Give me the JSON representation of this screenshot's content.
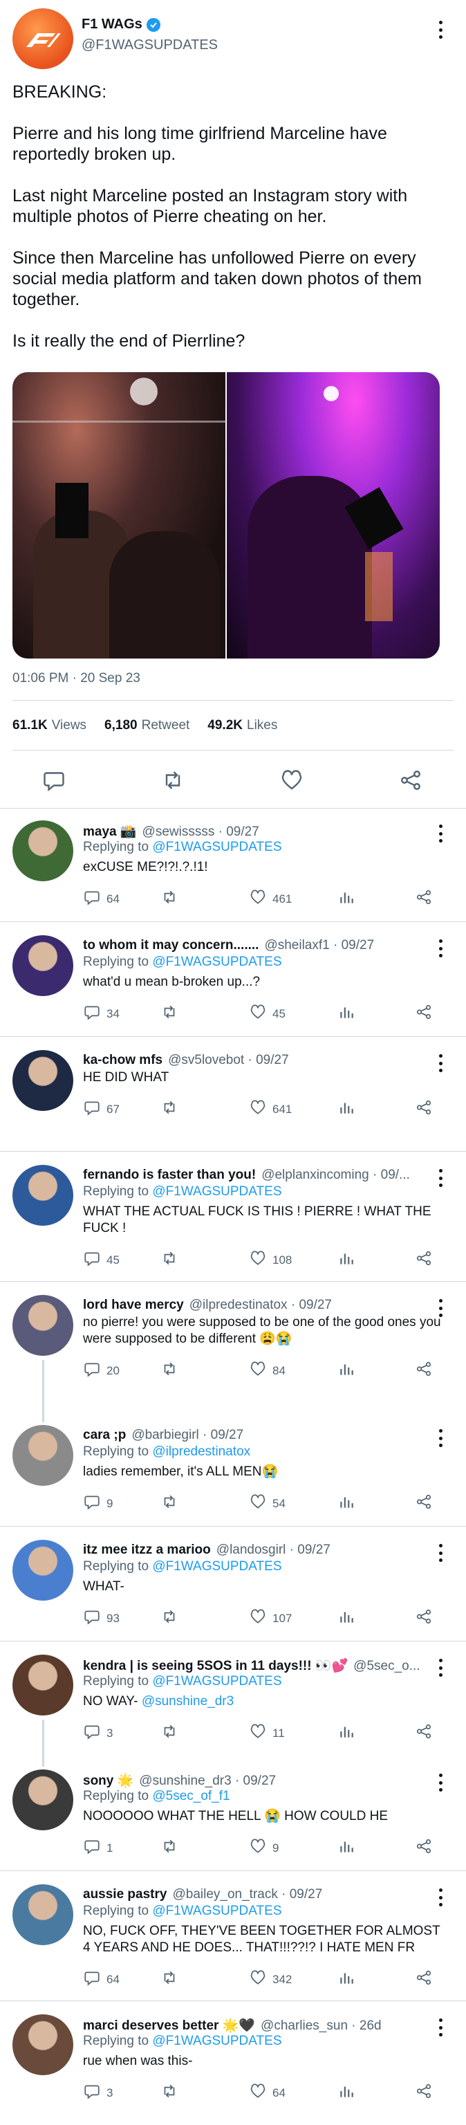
{
  "main_tweet": {
    "name": "F1 WAGs",
    "handle": "@F1WAGSUPDATES",
    "body": "BREAKING:\n\nPierre and his long time girlfriend Marceline have reportedly broken up.\n\nLast night Marceline posted an Instagram story with multiple photos of Pierre cheating on her.\n\nSince then Marceline has unfollowed Pierre on every social media platform and taken down photos of them together.\n\nIs it really the end of Pierrline?",
    "timestamp": "01:06 PM · 20 Sep 23",
    "views_count": "61.1K",
    "views_label": "Views",
    "retweets_count": "6,180",
    "retweets_label": "Retweet",
    "likes_count": "49.2K",
    "likes_label": "Likes"
  },
  "replies": [
    {
      "name": "maya 📸",
      "handle": "@sewisssss · 09/27",
      "replying_label": "Replying to",
      "replying_to": "@F1WAGSUPDATES",
      "text": "exCUSE ME?!?!.?.!1!",
      "mention": "",
      "comments": "64",
      "retweets": "",
      "likes": "461",
      "avatar": "#3f6a35"
    },
    {
      "name": "to whom it may concern.......",
      "handle": "@sheilaxf1 · 09/27",
      "replying_label": "Replying to",
      "replying_to": "@F1WAGSUPDATES",
      "text": "what'd u mean b-broken up...?",
      "mention": "",
      "comments": "34",
      "retweets": "",
      "likes": "45",
      "avatar": "#3b2a6e"
    },
    {
      "name": "ka-chow mfs",
      "handle": "@sv5lovebot · 09/27",
      "replying_label": "",
      "replying_to": "",
      "text": "HE DID WHAT",
      "mention": "",
      "comments": "67",
      "retweets": "",
      "likes": "641",
      "avatar": "#1e2a44"
    },
    {
      "name": "fernando is faster than you!",
      "handle": "@elplanxincoming · 09/...",
      "replying_label": "Replying to",
      "replying_to": "@F1WAGSUPDATES",
      "text": "WHAT THE ACTUAL FUCK IS THIS ! PIERRE ! WHAT THE FUCK !",
      "mention": "",
      "comments": "45",
      "retweets": "",
      "likes": "108",
      "avatar": "#2c5a9a"
    },
    {
      "name": "lord have mercy",
      "handle": "@ilpredestinatox · 09/27",
      "replying_label": "",
      "replying_to": "",
      "text": "no pierre! you were supposed to be one of the good ones you were supposed to be different 😩😭",
      "mention": "",
      "comments": "20",
      "retweets": "",
      "likes": "84",
      "avatar": "#5a5a7a"
    },
    {
      "name": "cara ;p",
      "handle": "@barbiegirl · 09/27",
      "replying_label": "Replying to",
      "replying_to": "@ilpredestinatox",
      "text": "ladies remember, it's ALL MEN😭",
      "mention": "",
      "comments": "9",
      "retweets": "",
      "likes": "54",
      "avatar": "#8a8a8a"
    },
    {
      "name": "itz mee itzz a marioo",
      "handle": "@landosgirl · 09/27",
      "replying_label": "Replying to",
      "replying_to": "@F1WAGSUPDATES",
      "text": "WHAT-",
      "mention": "",
      "comments": "93",
      "retweets": "",
      "likes": "107",
      "avatar": "#4a7fd0"
    },
    {
      "name": "kendra | is seeing 5SOS in 11 days!!! 👀💕",
      "handle": "@5sec_o...",
      "replying_label": "Replying to",
      "replying_to": "@F1WAGSUPDATES",
      "text": "NO WAY- ",
      "mention": "@sunshine_dr3",
      "comments": "3",
      "retweets": "",
      "likes": "11",
      "avatar": "#5a3a2a"
    },
    {
      "name": "sony 🌟",
      "handle": "@sunshine_dr3 · 09/27",
      "replying_label": "Replying to",
      "replying_to": "@5sec_of_f1",
      "text": "NOOOOOO WHAT THE HELL 😭 HOW COULD HE",
      "mention": "",
      "comments": "1",
      "retweets": "",
      "likes": "9",
      "avatar": "#3a3a3a"
    },
    {
      "name": "aussie pastry",
      "handle": "@bailey_on_track · 09/27",
      "replying_label": "Replying to",
      "replying_to": "@F1WAGSUPDATES",
      "text": "NO, FUCK OFF, THEY'VE BEEN TOGETHER FOR ALMOST 4 YEARS AND HE DOES... THAT!!!??!? I HATE MEN FR",
      "mention": "",
      "comments": "64",
      "retweets": "",
      "likes": "342",
      "avatar": "#4a7aa0"
    },
    {
      "name": "marci deserves better 🌟🖤",
      "handle": "@charlies_sun · 26d",
      "replying_label": "Replying to",
      "replying_to": "@F1WAGSUPDATES",
      "text": "rue when was this-",
      "mention": "",
      "comments": "3",
      "retweets": "",
      "likes": "64",
      "avatar": "#6a4a3a"
    }
  ],
  "icons": {
    "more": "more-icon",
    "reply": "reply-icon",
    "retweet": "retweet-icon",
    "like": "heart-icon",
    "views": "views-icon",
    "share": "share-icon"
  },
  "colors": {
    "accent": "#1d9bf0",
    "secondary_text": "#536471",
    "divider": "#cfd9de"
  }
}
